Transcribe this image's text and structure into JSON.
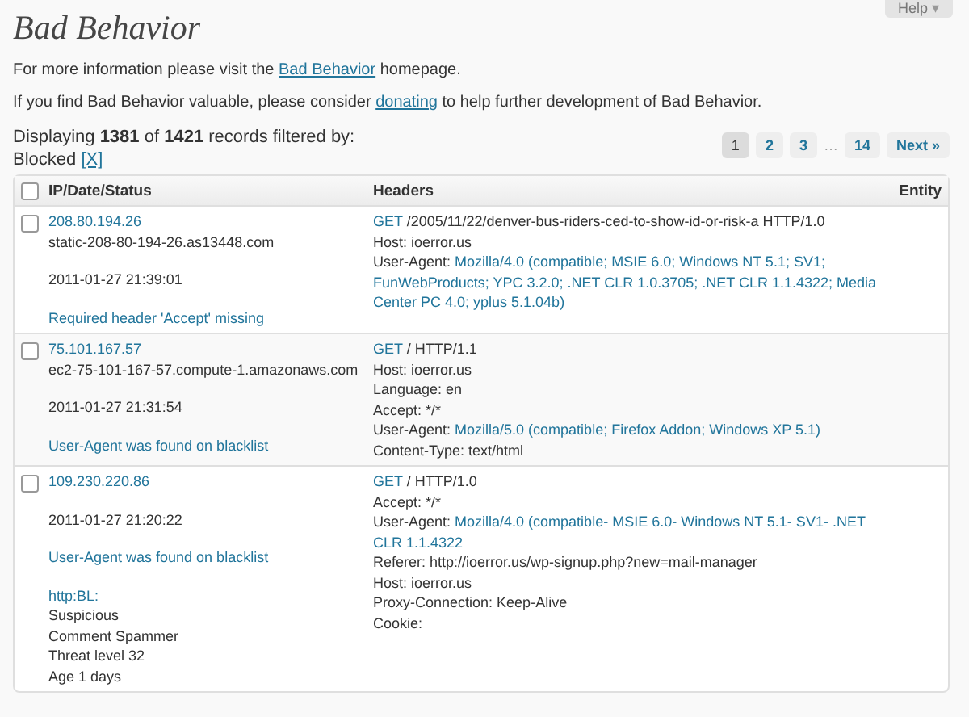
{
  "help_button": {
    "label": "Help",
    "caret": "▾"
  },
  "title": "Bad Behavior",
  "intro": [
    {
      "before": "For more information please visit the ",
      "link": "Bad Behavior",
      "after": " homepage."
    },
    {
      "before": "If you find Bad Behavior valuable, please consider ",
      "link": "donating",
      "after": " to help further development of Bad Behavior."
    }
  ],
  "summary": "Displaying **1381** of **1421** records filtered by:",
  "filter": {
    "label": "Blocked",
    "clear": "[X]"
  },
  "pagination": [
    {
      "kind": "page",
      "label": "1",
      "selected": true
    },
    {
      "kind": "page",
      "label": "2",
      "selected": false
    },
    {
      "kind": "page",
      "label": "3",
      "selected": false
    },
    {
      "kind": "ellipsis",
      "label": "…"
    },
    {
      "kind": "page",
      "label": "14",
      "selected": false
    },
    {
      "kind": "page",
      "label": "Next »",
      "selected": false
    }
  ],
  "table": {
    "select_all": {
      "checked": false
    },
    "columns": [
      "IP/Date/Status",
      "Headers",
      "Entity"
    ],
    "rows": [
      {
        "checked": false,
        "info": [
          {
            "kind": "link",
            "text": "208.80.194.26"
          },
          {
            "kind": "text",
            "text": "static-208-80-194-26.as13448.com"
          },
          {
            "kind": "gap"
          },
          {
            "kind": "text",
            "text": "2011-01-27 21:39:01"
          },
          {
            "kind": "gap"
          },
          {
            "kind": "link",
            "text": "Required header 'Accept' missing"
          }
        ],
        "headers": [
          {
            "kind": "request",
            "name": "GET",
            "value": "/2005/11/22/denver-bus-riders-ced-to-show-id-or-risk-a HTTP/1.0"
          },
          {
            "kind": "plain",
            "name": "Host:",
            "value": "ioerror.us"
          },
          {
            "kind": "agent",
            "name": "User-Agent:",
            "value": "Mozilla/4.0 (compatible; MSIE 6.0; Windows NT 5.1; SV1; FunWebProducts; YPC 3.2.0; .NET CLR 1.0.3705; .NET CLR 1.1.4322; Media Center PC 4.0; yplus 5.1.04b)"
          }
        ]
      },
      {
        "checked": false,
        "info": [
          {
            "kind": "link",
            "text": "75.101.167.57"
          },
          {
            "kind": "text",
            "text": "ec2-75-101-167-57.compute-1.amazonaws.com"
          },
          {
            "kind": "gap"
          },
          {
            "kind": "text",
            "text": "2011-01-27 21:31:54"
          },
          {
            "kind": "gap"
          },
          {
            "kind": "link",
            "text": "User-Agent was found on blacklist"
          }
        ],
        "headers": [
          {
            "kind": "request",
            "name": "GET",
            "value": "/ HTTP/1.1"
          },
          {
            "kind": "plain",
            "name": "Host:",
            "value": "ioerror.us"
          },
          {
            "kind": "plain",
            "name": "Language:",
            "value": "en"
          },
          {
            "kind": "plain",
            "name": "Accept:",
            "value": "*/*"
          },
          {
            "kind": "agent",
            "name": "User-Agent:",
            "value": "Mozilla/5.0 (compatible; Firefox Addon; Windows XP 5.1)"
          },
          {
            "kind": "plain",
            "name": "Content-Type:",
            "value": "text/html"
          }
        ]
      },
      {
        "checked": false,
        "info": [
          {
            "kind": "link",
            "text": "109.230.220.86"
          },
          {
            "kind": "gap"
          },
          {
            "kind": "text",
            "text": "2011-01-27 21:20:22"
          },
          {
            "kind": "gap"
          },
          {
            "kind": "link",
            "text": "User-Agent was found on blacklist"
          },
          {
            "kind": "gap"
          },
          {
            "kind": "link",
            "text": "http:BL:"
          },
          {
            "kind": "text",
            "text": "Suspicious"
          },
          {
            "kind": "text",
            "text": "Comment Spammer"
          },
          {
            "kind": "text",
            "text": "Threat level 32"
          },
          {
            "kind": "text",
            "text": "Age 1 days"
          }
        ],
        "headers": [
          {
            "kind": "request",
            "name": "GET",
            "value": "/ HTTP/1.0"
          },
          {
            "kind": "plain",
            "name": "Accept:",
            "value": "*/*"
          },
          {
            "kind": "agent",
            "name": "User-Agent:",
            "value": "Mozilla/4.0 (compatible- MSIE 6.0- Windows NT 5.1- SV1- .NET CLR 1.1.4322"
          },
          {
            "kind": "plain",
            "name": "Referer:",
            "value": "http://ioerror.us/wp-signup.php?new=mail-manager"
          },
          {
            "kind": "plain",
            "name": "Host:",
            "value": "ioerror.us"
          },
          {
            "kind": "plain",
            "name": "Proxy-Connection:",
            "value": "Keep-Alive"
          },
          {
            "kind": "plain",
            "name": "Cookie:"
          }
        ]
      }
    ]
  }
}
